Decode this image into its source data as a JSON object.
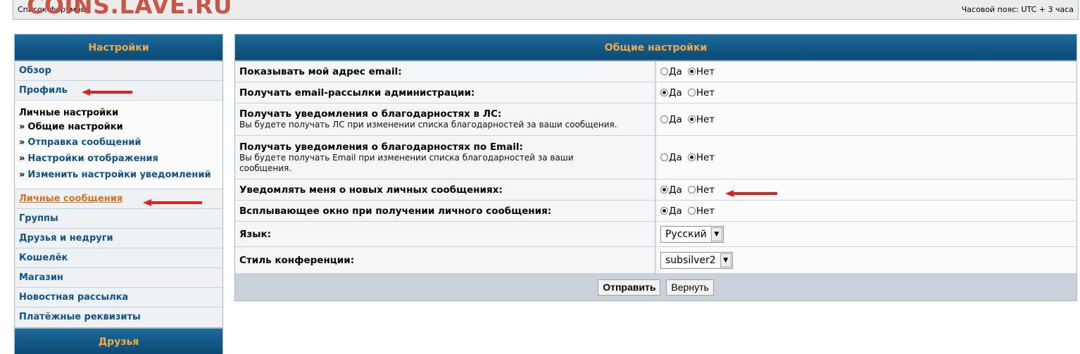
{
  "header": {
    "breadcrumb": "Список форумов",
    "timezone": "Часовой пояс: UTC + 3 часа",
    "watermark": "COINS.LAVE.RU"
  },
  "sidebar": {
    "title": "Настройки",
    "items_top": [
      "Обзор",
      "Профиль"
    ],
    "section_title": "Личные настройки",
    "subitems": [
      {
        "label": "Общие настройки",
        "current": true
      },
      {
        "label": "Отправка сообщений",
        "current": false
      },
      {
        "label": "Настройки отображения",
        "current": false
      },
      {
        "label": "Изменить настройки уведомлений",
        "current": false
      }
    ],
    "active_item": "Личные сообщения",
    "items_bottom": [
      "Группы",
      "Друзья и недруги",
      "Кошелёк",
      "Магазин",
      "Новостная рассылка",
      "Платёжные реквизиты"
    ],
    "friends_title": "Друзья"
  },
  "main": {
    "title": "Общие настройки",
    "yes": "Да",
    "no": "Нет",
    "rows": [
      {
        "label": "Показывать мой адрес email:",
        "desc": "",
        "value": "Нет"
      },
      {
        "label": "Получать email-рассылки администрации:",
        "desc": "",
        "value": "Да"
      },
      {
        "label": "Получать уведомления о благодарностях в ЛС:",
        "desc": "Вы будете получать ЛС при изменении списка благодарностей за ваши сообщения.",
        "value": "Нет"
      },
      {
        "label": "Получать уведомления о благодарностях по Email:",
        "desc": "Вы будете получать Email при изменении списка благодарностей за ваши сообщения.",
        "value": "Нет"
      },
      {
        "label": "Уведомлять меня о новых личных сообщениях:",
        "desc": "",
        "value": "Да"
      },
      {
        "label": "Всплывающее окно при получении личного сообщения:",
        "desc": "",
        "value": "Да"
      }
    ],
    "language_label": "Язык:",
    "language_value": "Русский",
    "style_label": "Стиль конференции:",
    "style_value": "subsilver2",
    "submit_label": "Отправить",
    "reset_label": "Вернуть"
  },
  "colors": {
    "header_bg": "#0b4a74",
    "header_text": "#f3a84a",
    "link": "#105289",
    "active_link": "#d3721e",
    "annotation": "#e02020"
  }
}
